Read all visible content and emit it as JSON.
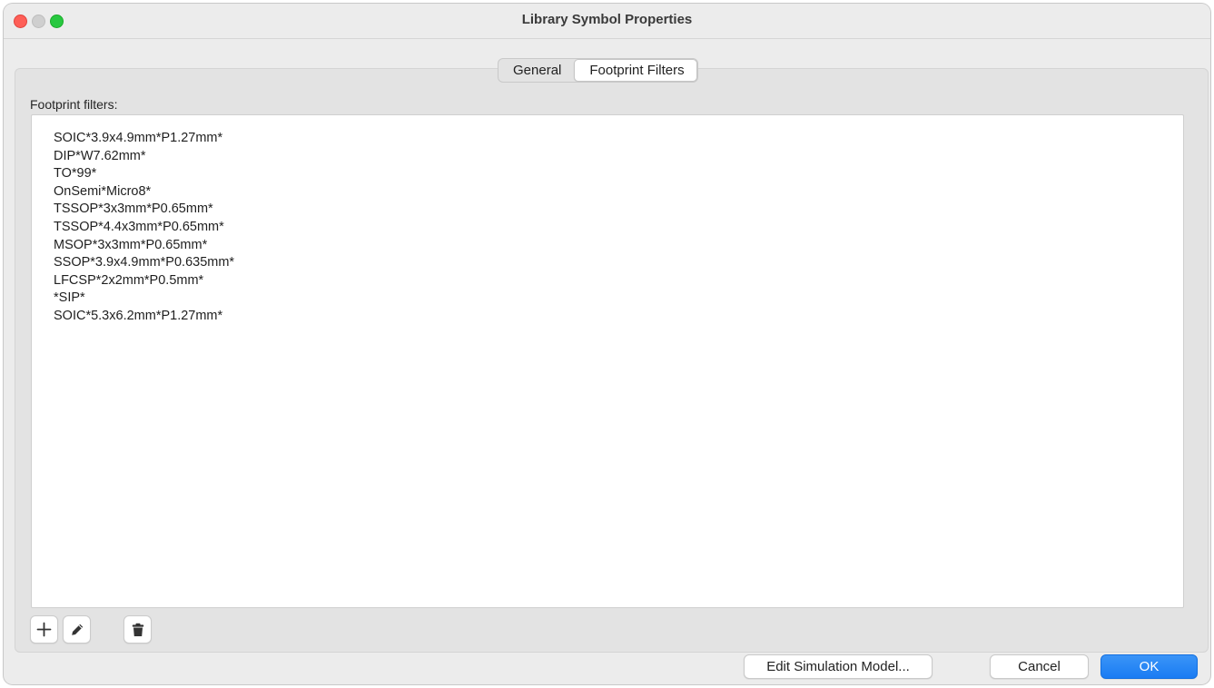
{
  "window": {
    "title": "Library Symbol Properties"
  },
  "tabs": [
    {
      "label": "General",
      "active": false
    },
    {
      "label": "Footprint Filters",
      "active": true
    }
  ],
  "footprint_filters": {
    "label": "Footprint filters:",
    "items": [
      "SOIC*3.9x4.9mm*P1.27mm*",
      "DIP*W7.62mm*",
      "TO*99*",
      "OnSemi*Micro8*",
      "TSSOP*3x3mm*P0.65mm*",
      "TSSOP*4.4x3mm*P0.65mm*",
      "MSOP*3x3mm*P0.65mm*",
      "SSOP*3.9x4.9mm*P0.635mm*",
      "LFCSP*2x2mm*P0.5mm*",
      "*SIP*",
      "SOIC*5.3x6.2mm*P1.27mm*"
    ]
  },
  "list_toolbar": {
    "add_icon": "plus-icon",
    "edit_icon": "pencil-icon",
    "delete_icon": "trash-icon"
  },
  "buttons": {
    "edit_sim": "Edit Simulation Model...",
    "cancel": "Cancel",
    "ok": "OK"
  },
  "colors": {
    "accent": "#1f86f7",
    "close": "#fe5f57",
    "minimize": "#cfcfcf",
    "maximize": "#28c840"
  }
}
